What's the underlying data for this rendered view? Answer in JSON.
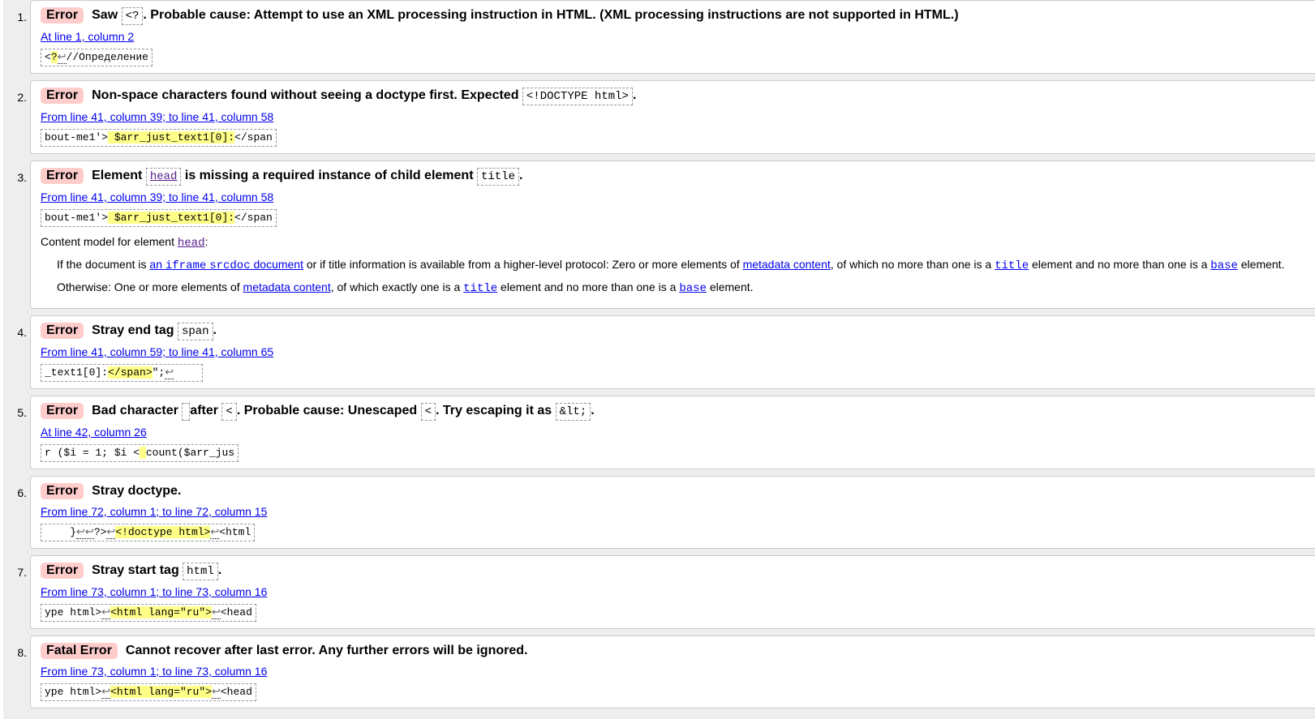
{
  "colors": {
    "badge_bg": "#ffcccc",
    "highlight": "#ffff88",
    "link": "#0000ee"
  },
  "messages": [
    {
      "number": "1.",
      "type": "Error",
      "parts": [
        {
          "t": "Saw "
        },
        {
          "c": "<?"
        },
        {
          "t": ". Probable cause: Attempt to use an XML processing instruction in HTML. (XML processing instructions are not supported in HTML.)"
        }
      ],
      "location": "At line 1, column 2",
      "extract": [
        {
          "t": "<"
        },
        {
          "h": "?"
        },
        {
          "lf": "↩"
        },
        {
          "t": "//Определение"
        }
      ]
    },
    {
      "number": "2.",
      "type": "Error",
      "parts": [
        {
          "t": "Non-space characters found without seeing a doctype first. Expected "
        },
        {
          "c": "<!DOCTYPE html>"
        },
        {
          "t": "."
        }
      ],
      "location": "From line 41, column 39; to line 41, column 58",
      "extract": [
        {
          "t": "bout-me1'>"
        },
        {
          "h": " $arr_just_text1[0]:"
        },
        {
          "t": "</span"
        }
      ]
    },
    {
      "number": "3.",
      "type": "Error",
      "parts": [
        {
          "t": "Element "
        },
        {
          "c": "head",
          "link": true
        },
        {
          "t": " is missing a required instance of child element "
        },
        {
          "c": "title"
        },
        {
          "t": "."
        }
      ],
      "location": "From line 41, column 39; to line 41, column 58",
      "extract": [
        {
          "t": "bout-me1'>"
        },
        {
          "h": " $arr_just_text1[0]:"
        },
        {
          "t": "</span"
        }
      ],
      "content_model": {
        "label": "Content model for element ",
        "element": "head",
        "colon": ":",
        "p1": [
          {
            "t": "If the document is "
          },
          {
            "a": "an "
          },
          {
            "am": "iframe"
          },
          {
            "a": " "
          },
          {
            "am": "srcdoc"
          },
          {
            "a": " document"
          },
          {
            "t": " or if title information is available from a higher-level protocol: Zero or more elements of "
          },
          {
            "a": "metadata content"
          },
          {
            "t": ", of which no more than one is a "
          },
          {
            "am": "title"
          },
          {
            "t": " element and no more than one is a "
          },
          {
            "am": "base"
          },
          {
            "t": " element."
          }
        ],
        "p2": [
          {
            "t": "Otherwise: One or more elements of "
          },
          {
            "a": "metadata content"
          },
          {
            "t": ", of which exactly one is a "
          },
          {
            "am": "title"
          },
          {
            "t": " element and no more than one is a "
          },
          {
            "am": "base"
          },
          {
            "t": " element."
          }
        ]
      }
    },
    {
      "number": "4.",
      "type": "Error",
      "parts": [
        {
          "t": "Stray end tag "
        },
        {
          "c": "span"
        },
        {
          "t": "."
        }
      ],
      "location": "From line 41, column 59; to line 41, column 65",
      "extract": [
        {
          "t": "_text1[0]:"
        },
        {
          "h": "</span>"
        },
        {
          "t": "\";"
        },
        {
          "lf": "↩"
        },
        {
          "t": "    "
        }
      ]
    },
    {
      "number": "5.",
      "type": "Error",
      "parts": [
        {
          "t": "Bad character "
        },
        {
          "c": "  "
        },
        {
          "t": " after "
        },
        {
          "c": "<"
        },
        {
          "t": ". Probable cause: Unescaped "
        },
        {
          "c": "<"
        },
        {
          "t": ". Try escaping it as "
        },
        {
          "c": "&lt;"
        },
        {
          "t": "."
        }
      ],
      "location": "At line 42, column 26",
      "extract": [
        {
          "t": "r ($i = 1; $i <"
        },
        {
          "h": " "
        },
        {
          "t": "count($arr_jus"
        }
      ]
    },
    {
      "number": "6.",
      "type": "Error",
      "parts": [
        {
          "t": "Stray doctype."
        }
      ],
      "location": "From line 72, column 1; to line 72, column 15",
      "extract": [
        {
          "t": "    }"
        },
        {
          "lf": "↩↩"
        },
        {
          "t": "?>"
        },
        {
          "lf": "↩"
        },
        {
          "h": "<!doctype html>"
        },
        {
          "lf": "↩"
        },
        {
          "t": "<html"
        }
      ]
    },
    {
      "number": "7.",
      "type": "Error",
      "parts": [
        {
          "t": "Stray start tag "
        },
        {
          "c": "html"
        },
        {
          "t": "."
        }
      ],
      "location": "From line 73, column 1; to line 73, column 16",
      "extract": [
        {
          "t": "ype html>"
        },
        {
          "lf": "↩"
        },
        {
          "h": "<html lang=\"ru\">"
        },
        {
          "lf": "↩"
        },
        {
          "t": "<head"
        }
      ]
    },
    {
      "number": "8.",
      "type": "Fatal Error",
      "parts": [
        {
          "t": "Cannot recover after last error. Any further errors will be ignored."
        }
      ],
      "location": "From line 73, column 1; to line 73, column 16",
      "extract": [
        {
          "t": "ype html>"
        },
        {
          "lf": "↩"
        },
        {
          "h": "<html lang=\"ru\">"
        },
        {
          "lf": "↩"
        },
        {
          "t": "<head"
        }
      ]
    }
  ]
}
